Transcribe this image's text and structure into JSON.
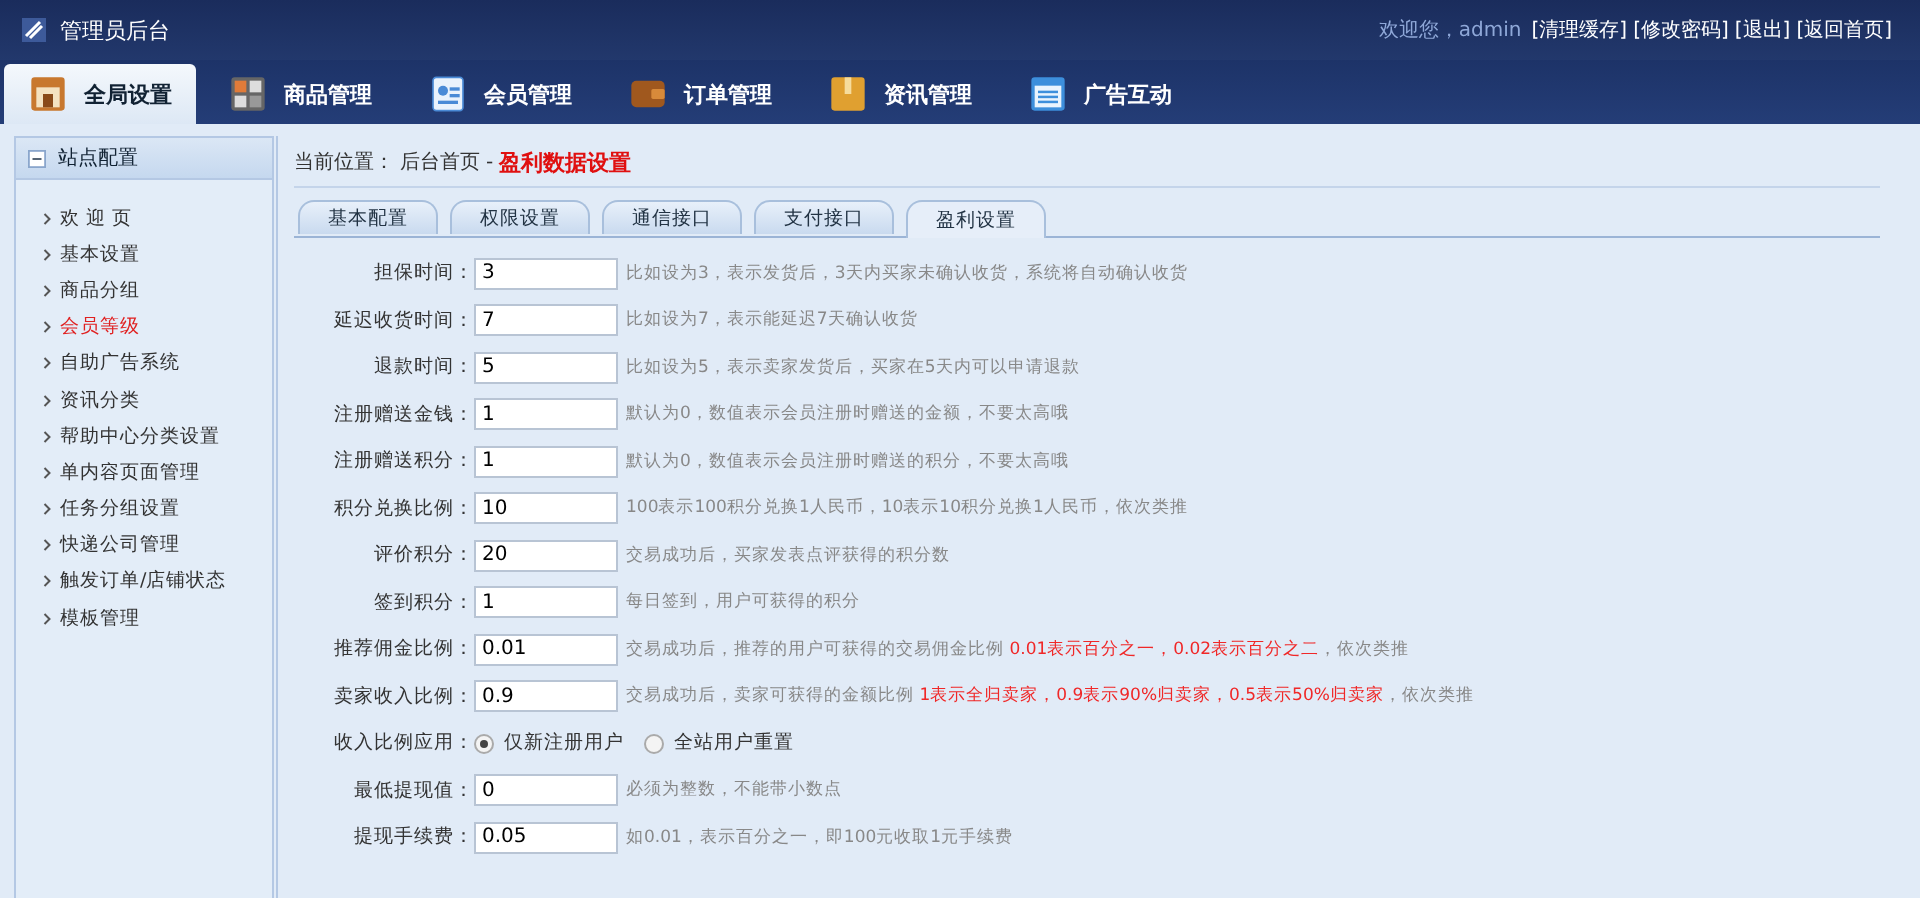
{
  "header": {
    "title": "管理员后台",
    "welcome": "欢迎您，admin",
    "links": [
      "[清理缓存]",
      "[修改密码]",
      "[退出]",
      "[返回首页]"
    ]
  },
  "nav": [
    {
      "label": "全局设置",
      "selected": true
    },
    {
      "label": "商品管理",
      "selected": false
    },
    {
      "label": "会员管理",
      "selected": false
    },
    {
      "label": "订单管理",
      "selected": false
    },
    {
      "label": "资讯管理",
      "selected": false
    },
    {
      "label": "广告互动",
      "selected": false
    }
  ],
  "sidebar": {
    "title": "站点配置",
    "items": [
      {
        "label": "欢 迎 页",
        "selected": false
      },
      {
        "label": "基本设置",
        "selected": false
      },
      {
        "label": "商品分组",
        "selected": false
      },
      {
        "label": "会员等级",
        "selected": true
      },
      {
        "label": "自助广告系统",
        "selected": false
      },
      {
        "label": "资讯分类",
        "selected": false
      },
      {
        "label": "帮助中心分类设置",
        "selected": false
      },
      {
        "label": "单内容页面管理",
        "selected": false
      },
      {
        "label": "任务分组设置",
        "selected": false
      },
      {
        "label": "快递公司管理",
        "selected": false
      },
      {
        "label": "触发订单/店铺状态",
        "selected": false
      },
      {
        "label": "模板管理",
        "selected": false
      }
    ]
  },
  "breadcrumb": {
    "prefix": "当前位置：",
    "home": "后台首页",
    "separator": "-",
    "current": "盈利数据设置"
  },
  "tabs": [
    {
      "label": "基本配置",
      "selected": false
    },
    {
      "label": "权限设置",
      "selected": false
    },
    {
      "label": "通信接口",
      "selected": false
    },
    {
      "label": "支付接口",
      "selected": false
    },
    {
      "label": "盈利设置",
      "selected": true
    }
  ],
  "form": [
    {
      "kind": "text",
      "label": "担保时间：",
      "value": "3",
      "hint": [
        {
          "text": "比如设为3，表示发货后，3天内买家未确认收货，系统将自动确认收货",
          "highlight": false
        }
      ]
    },
    {
      "kind": "text",
      "label": "延迟收货时间：",
      "value": "7",
      "hint": [
        {
          "text": "比如设为7，表示能延迟7天确认收货",
          "highlight": false
        }
      ]
    },
    {
      "kind": "text",
      "label": "退款时间：",
      "value": "5",
      "hint": [
        {
          "text": "比如设为5，表示卖家发货后，买家在5天内可以申请退款",
          "highlight": false
        }
      ]
    },
    {
      "kind": "text",
      "label": "注册赠送金钱：",
      "value": "1",
      "hint": [
        {
          "text": "默认为0，数值表示会员注册时赠送的金额，不要太高哦",
          "highlight": false
        }
      ]
    },
    {
      "kind": "text",
      "label": "注册赠送积分：",
      "value": "1",
      "hint": [
        {
          "text": "默认为0，数值表示会员注册时赠送的积分，不要太高哦",
          "highlight": false
        }
      ]
    },
    {
      "kind": "text",
      "label": "积分兑换比例：",
      "value": "10",
      "hint": [
        {
          "text": "100表示100积分兑换1人民币，10表示10积分兑换1人民币，依次类推",
          "highlight": false
        }
      ]
    },
    {
      "kind": "text",
      "label": "评价积分：",
      "value": "20",
      "hint": [
        {
          "text": "交易成功后，买家发表点评获得的积分数",
          "highlight": false
        }
      ]
    },
    {
      "kind": "text",
      "label": "签到积分：",
      "value": "1",
      "hint": [
        {
          "text": "每日签到，用户可获得的积分",
          "highlight": false
        }
      ]
    },
    {
      "kind": "text",
      "label": "推荐佣金比例：",
      "value": "0.01",
      "hint": [
        {
          "text": "交易成功后，推荐的用户可获得的交易佣金比例 ",
          "highlight": false
        },
        {
          "text": "0.01表示百分之一，0.02表示百分之二",
          "highlight": true
        },
        {
          "text": "，依次类推",
          "highlight": false
        }
      ]
    },
    {
      "kind": "text",
      "label": "卖家收入比例：",
      "value": "0.9",
      "hint": [
        {
          "text": "交易成功后，卖家可获得的金额比例 ",
          "highlight": false
        },
        {
          "text": "1表示全归卖家，0.9表示90%归卖家，0.5表示50%归卖家",
          "highlight": true
        },
        {
          "text": "，依次类推",
          "highlight": false
        }
      ]
    },
    {
      "kind": "radio",
      "label": "收入比例应用：",
      "options": [
        {
          "label": "仅新注册用户",
          "selected": true
        },
        {
          "label": "全站用户重置",
          "selected": false
        }
      ]
    },
    {
      "kind": "text",
      "label": "最低提现值：",
      "value": "0",
      "hint": [
        {
          "text": "必须为整数，不能带小数点",
          "highlight": false
        }
      ]
    },
    {
      "kind": "text",
      "label": "提现手续费：",
      "value": "0.05",
      "hint": [
        {
          "text": "如0.01，表示百分之一，即100元收取1元手续费",
          "highlight": false
        }
      ]
    }
  ]
}
